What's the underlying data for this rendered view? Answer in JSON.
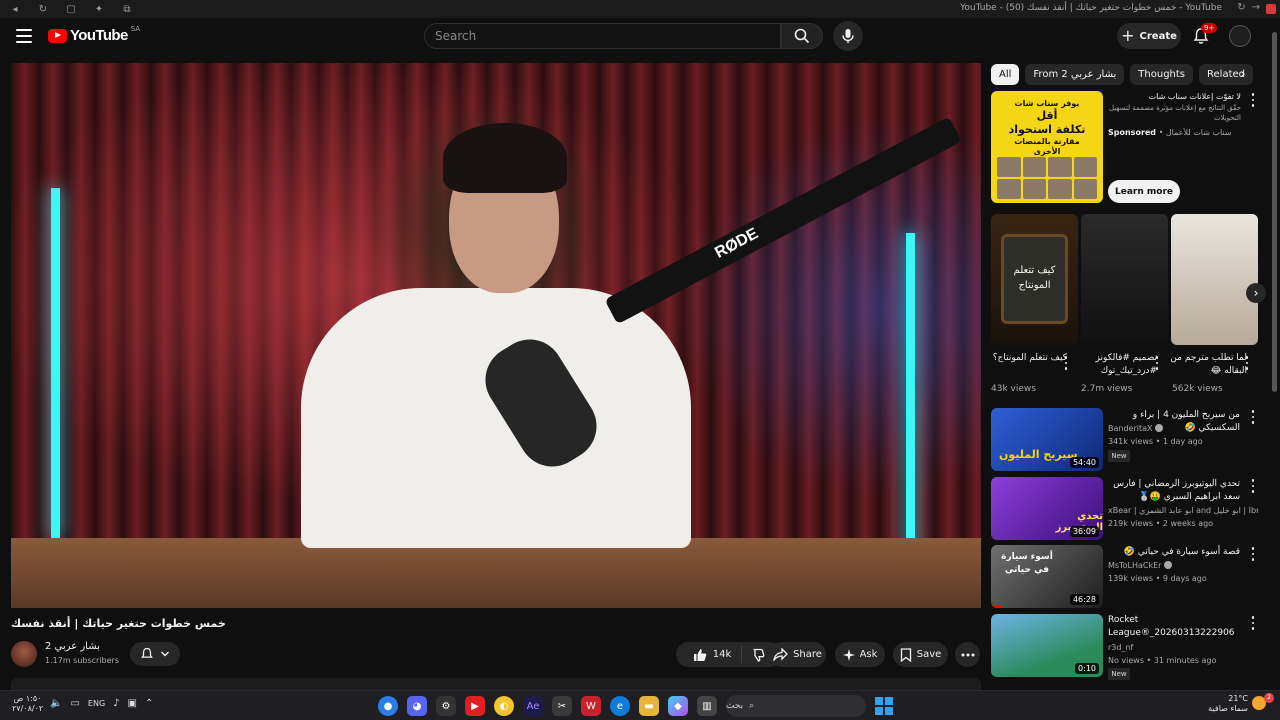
{
  "browser": {
    "title": "YouTube - خمس خطوات حتغير حياتك | أنقذ نفسك (50) - YouTube"
  },
  "masthead": {
    "logo_text": "YouTube",
    "country_code": "SA",
    "search_placeholder": "Search",
    "create_label": "Create",
    "notification_count": "9+"
  },
  "video": {
    "title": "خمس خطوات حتغير حياتك | أنقذ نفسك",
    "mic_brand": "RØDE",
    "channel_name": "بشار عربي 2",
    "subscribers": "1.17m subscribers",
    "likes": "14k",
    "share_label": "Share",
    "ask_label": "Ask",
    "save_label": "Save"
  },
  "sidebar": {
    "chips": [
      "All",
      "From بشار عربي 2",
      "Thoughts",
      "Related"
    ],
    "ad": {
      "banner_top": "يوفر سناب شات",
      "banner_big1": "أقل",
      "banner_big2": "تكلفة استحواذ",
      "banner_sub": "مقارنة بالمنصات الأخرى",
      "title": "لا تفوّت إعلانات سناب شات",
      "description": "حقّق النتائج مع إعلانات مؤثرة مصممة لتسهيل التحويلات",
      "sponsored": "Sponsored",
      "advertiser": "سناب شات للأعمال",
      "learn_more": "Learn more"
    },
    "shorts": [
      {
        "title": "كيف تتعلم المونتاج؟",
        "views": "43k views",
        "thumb_text": "كيف تتعلم المونتاج"
      },
      {
        "title": "تصميم #فالكونز #درد_تيك_توك",
        "views": "2.7m views",
        "thumb_text": ""
      },
      {
        "title": "لما تطلب مترجم من البقاله 😂",
        "views": "562k views",
        "thumb_text": ""
      }
    ],
    "recommendations": [
      {
        "title": "من سيربح المليون 4 | براء و السكسيكي 🤣",
        "channel": "BanderitaX",
        "meta": "341k views • 1 day ago",
        "badge": "New",
        "duration": "54:40",
        "thumb_text": "سيربح المليون"
      },
      {
        "title": "تحدي اليوتيوبرز الرمضاني | فارس سعد ابراهيم السبري 🤑🥈",
        "channel": "xBear | ابو عابد الشمري and ابو خليل | Ibrahim",
        "meta": "219k views • 2 weeks ago",
        "badge": "",
        "duration": "36:09",
        "thumb_text": "تحدي اليوتيوبرز"
      },
      {
        "title": "قصة أسوء سيارة في حياتي 🤣",
        "channel": "MsToLHaCkEr",
        "meta": "139k views • 9 days ago",
        "badge": "",
        "duration": "46:28",
        "thumb_text": "أسوء سيارة في حياتي"
      },
      {
        "title": "Rocket League®_20260313222906",
        "channel": "r3d_nf",
        "meta": "No views • 31 minutes ago",
        "badge": "New",
        "duration": "0:10",
        "thumb_text": ""
      }
    ]
  },
  "taskbar": {
    "time": "١:٥٠ ص",
    "date": "٢٧/٠٨/٠٢",
    "language": "ENG",
    "search_text": "بحث",
    "temperature": "21°C",
    "weather": "سماء صافية",
    "notifications": "2"
  },
  "colors": {
    "accent": "#ff0000",
    "background": "#0f0f0f",
    "chip_bg": "#272727",
    "ad_yellow": "#f5d617"
  }
}
